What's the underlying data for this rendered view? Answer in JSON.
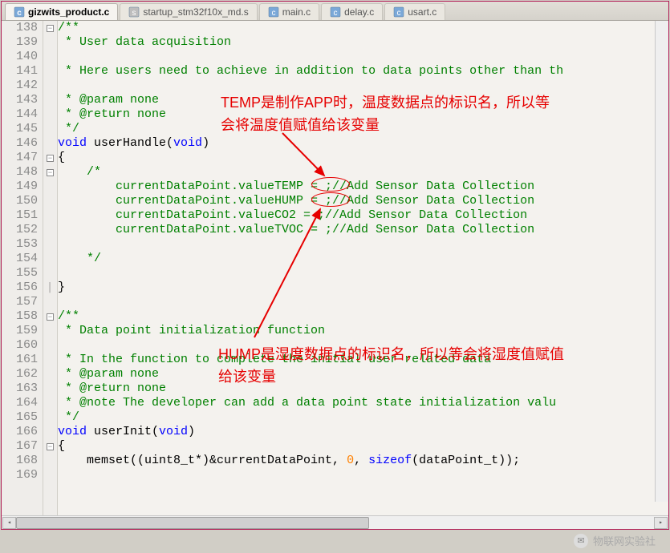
{
  "tabs": [
    {
      "label": "gizwits_product.c",
      "active": true,
      "icon": "c"
    },
    {
      "label": "startup_stm32f10x_md.s",
      "active": false,
      "icon": "s"
    },
    {
      "label": "main.c",
      "active": false,
      "icon": "c"
    },
    {
      "label": "delay.c",
      "active": false,
      "icon": "c"
    },
    {
      "label": "usart.c",
      "active": false,
      "icon": "c"
    }
  ],
  "line_start": 138,
  "lines": [
    {
      "n": 138,
      "fold": "[-]",
      "seg": [
        {
          "c": "cmt",
          "t": "/**"
        }
      ]
    },
    {
      "n": 139,
      "seg": [
        {
          "c": "cmt",
          "t": " * User data acquisition"
        }
      ]
    },
    {
      "n": 140,
      "seg": [
        {
          "c": "cmt",
          "t": ""
        }
      ]
    },
    {
      "n": 141,
      "seg": [
        {
          "c": "cmt",
          "t": " * Here users need to achieve in addition to data points other than th"
        }
      ]
    },
    {
      "n": 142,
      "seg": [
        {
          "c": "cmt",
          "t": ""
        }
      ]
    },
    {
      "n": 143,
      "seg": [
        {
          "c": "cmt",
          "t": " * @param none"
        }
      ]
    },
    {
      "n": 144,
      "seg": [
        {
          "c": "cmt",
          "t": " * @return none"
        }
      ]
    },
    {
      "n": 145,
      "seg": [
        {
          "c": "cmt",
          "t": " */"
        }
      ]
    },
    {
      "n": 146,
      "seg": [
        {
          "c": "kw",
          "t": "void"
        },
        {
          "c": "idt",
          "t": " userHandle("
        },
        {
          "c": "kw",
          "t": "void"
        },
        {
          "c": "idt",
          "t": ")"
        }
      ]
    },
    {
      "n": 147,
      "fold": "[-]",
      "seg": [
        {
          "c": "idt",
          "t": "{"
        }
      ]
    },
    {
      "n": 148,
      "fold": "[-]",
      "seg": [
        {
          "c": "cmt",
          "t": "    /*"
        }
      ]
    },
    {
      "n": 149,
      "seg": [
        {
          "c": "cmt",
          "t": "        currentDataPoint.valueTEMP = ;//Add Sensor Data Collection"
        }
      ]
    },
    {
      "n": 150,
      "seg": [
        {
          "c": "cmt",
          "t": "        currentDataPoint.valueHUMP = ;//Add Sensor Data Collection"
        }
      ]
    },
    {
      "n": 151,
      "seg": [
        {
          "c": "cmt",
          "t": "        currentDataPoint.valueCO2 = ;//Add Sensor Data Collection"
        }
      ]
    },
    {
      "n": 152,
      "seg": [
        {
          "c": "cmt",
          "t": "        currentDataPoint.valueTVOC = ;//Add Sensor Data Collection"
        }
      ]
    },
    {
      "n": 153,
      "seg": [
        {
          "c": "cmt",
          "t": ""
        }
      ]
    },
    {
      "n": 154,
      "seg": [
        {
          "c": "cmt",
          "t": "    */"
        }
      ]
    },
    {
      "n": 155,
      "seg": [
        {
          "c": "idt",
          "t": ""
        }
      ]
    },
    {
      "n": 156,
      "fold": "|",
      "seg": [
        {
          "c": "idt",
          "t": "}"
        }
      ]
    },
    {
      "n": 157,
      "seg": [
        {
          "c": "idt",
          "t": ""
        }
      ]
    },
    {
      "n": 158,
      "fold": "[-]",
      "seg": [
        {
          "c": "cmt",
          "t": "/**"
        }
      ]
    },
    {
      "n": 159,
      "seg": [
        {
          "c": "cmt",
          "t": " * Data point initialization function"
        }
      ]
    },
    {
      "n": 160,
      "seg": [
        {
          "c": "cmt",
          "t": ""
        }
      ]
    },
    {
      "n": 161,
      "seg": [
        {
          "c": "cmt",
          "t": " * In the function to complete the initial user-related data"
        }
      ]
    },
    {
      "n": 162,
      "seg": [
        {
          "c": "cmt",
          "t": " * @param none"
        }
      ]
    },
    {
      "n": 163,
      "seg": [
        {
          "c": "cmt",
          "t": " * @return none"
        }
      ]
    },
    {
      "n": 164,
      "seg": [
        {
          "c": "cmt",
          "t": " * @note The developer can add a data point state initialization valu"
        }
      ]
    },
    {
      "n": 165,
      "seg": [
        {
          "c": "cmt",
          "t": " */"
        }
      ]
    },
    {
      "n": 166,
      "seg": [
        {
          "c": "kw",
          "t": "void"
        },
        {
          "c": "idt",
          "t": " userInit("
        },
        {
          "c": "kw",
          "t": "void"
        },
        {
          "c": "idt",
          "t": ")"
        }
      ]
    },
    {
      "n": 167,
      "fold": "[-]",
      "seg": [
        {
          "c": "idt",
          "t": "{"
        }
      ]
    },
    {
      "n": 168,
      "seg": [
        {
          "c": "idt",
          "t": "    memset((uint8_t*)&currentDataPoint, "
        },
        {
          "c": "num",
          "t": "0"
        },
        {
          "c": "idt",
          "t": ", "
        },
        {
          "c": "kw",
          "t": "sizeof"
        },
        {
          "c": "idt",
          "t": "(dataPoint_t));"
        }
      ]
    },
    {
      "n": 169,
      "seg": [
        {
          "c": "idt",
          "t": ""
        }
      ]
    }
  ],
  "annotations": {
    "top": "TEMP是制作APP时，温度数据点的标识名，所以等会将温度值赋值给该变量",
    "bottom": "HUMP是湿度数据点的标识名，所以等会将湿度值赋值给该变量"
  },
  "watermark": "物联网实验社"
}
